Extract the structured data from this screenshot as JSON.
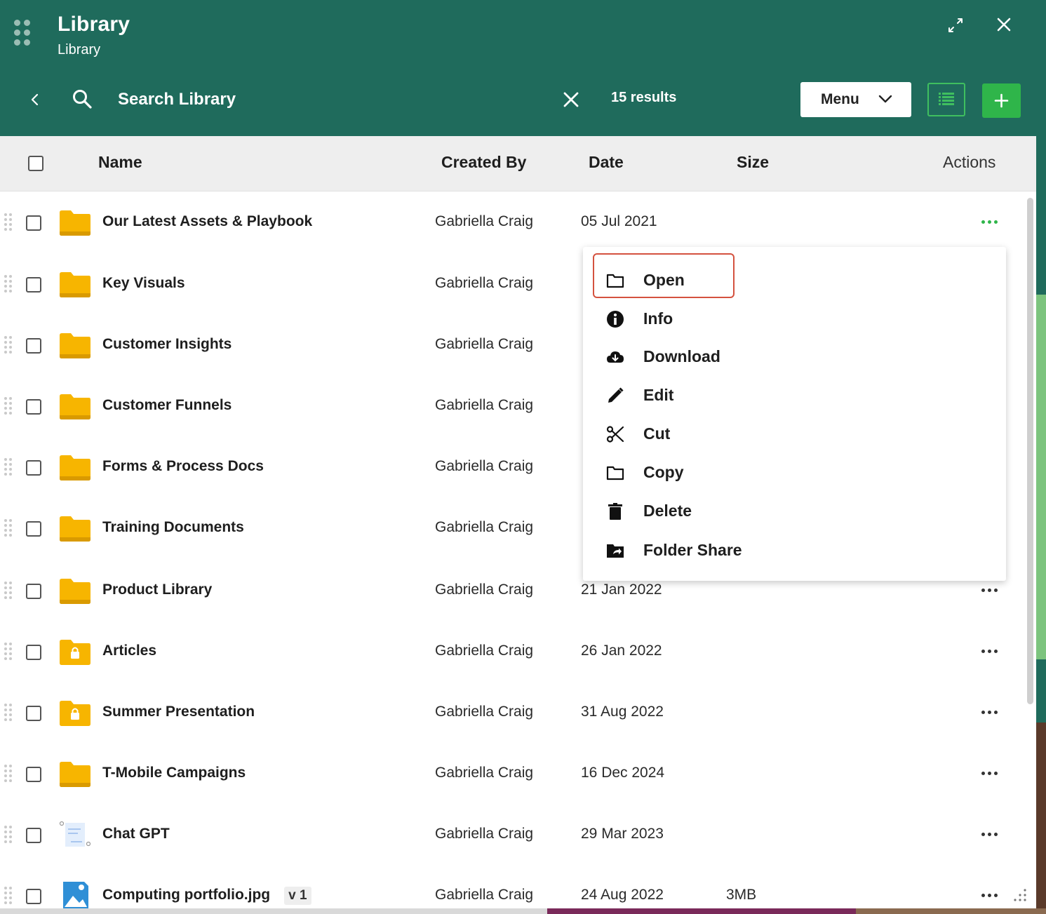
{
  "header": {
    "title": "Library",
    "subtitle": "Library",
    "search_placeholder": "Search Library",
    "results": "15 results",
    "menu_label": "Menu",
    "bg_color": "#1f6b5c",
    "accent_color": "#2fb54a"
  },
  "columns": {
    "name": "Name",
    "created_by": "Created By",
    "date": "Date",
    "size": "Size",
    "actions": "Actions"
  },
  "rows": [
    {
      "name": "Our Latest Assets & Playbook",
      "created_by": "Gabriella Craig",
      "date": "05 Jul 2021",
      "size": "",
      "icon": "folder-icon"
    },
    {
      "name": "Key Visuals",
      "created_by": "Gabriella Craig",
      "date": "",
      "size": "",
      "icon": "folder-icon"
    },
    {
      "name": "Customer Insights",
      "created_by": "Gabriella Craig",
      "date": "",
      "size": "",
      "icon": "folder-icon"
    },
    {
      "name": "Customer Funnels",
      "created_by": "Gabriella Craig",
      "date": "",
      "size": "",
      "icon": "folder-icon"
    },
    {
      "name": "Forms & Process Docs",
      "created_by": "Gabriella Craig",
      "date": "",
      "size": "",
      "icon": "folder-icon"
    },
    {
      "name": "Training Documents",
      "created_by": "Gabriella Craig",
      "date": "",
      "size": "",
      "icon": "folder-icon"
    },
    {
      "name": "Product Library",
      "created_by": "Gabriella Craig",
      "date": "21 Jan 2022",
      "size": "",
      "icon": "folder-icon"
    },
    {
      "name": "Articles",
      "created_by": "Gabriella Craig",
      "date": "26 Jan 2022",
      "size": "",
      "icon": "locked-folder-icon"
    },
    {
      "name": "Summer Presentation",
      "created_by": "Gabriella Craig",
      "date": "31 Aug 2022",
      "size": "",
      "icon": "locked-folder-icon"
    },
    {
      "name": "T-Mobile Campaigns",
      "created_by": "Gabriella Craig",
      "date": "16 Dec 2024",
      "size": "",
      "icon": "folder-icon"
    },
    {
      "name": "Chat GPT",
      "created_by": "Gabriella Craig",
      "date": "29 Mar 2023",
      "size": "",
      "icon": "document-icon"
    },
    {
      "name": "Computing portfolio.jpg",
      "created_by": "Gabriella Craig",
      "date": "24 Aug 2022",
      "size": "3MB",
      "icon": "image-file-icon",
      "version": "v 1"
    }
  ],
  "context_menu": {
    "items": [
      {
        "label": "Open",
        "icon": "folder-outline-icon"
      },
      {
        "label": "Info",
        "icon": "info-icon"
      },
      {
        "label": "Download",
        "icon": "cloud-download-icon"
      },
      {
        "label": "Edit",
        "icon": "pencil-icon"
      },
      {
        "label": "Cut",
        "icon": "scissors-icon"
      },
      {
        "label": "Copy",
        "icon": "folder-outline-icon"
      },
      {
        "label": "Delete",
        "icon": "trash-icon"
      },
      {
        "label": "Folder Share",
        "icon": "folder-share-icon"
      }
    ],
    "highlighted": "Open"
  }
}
